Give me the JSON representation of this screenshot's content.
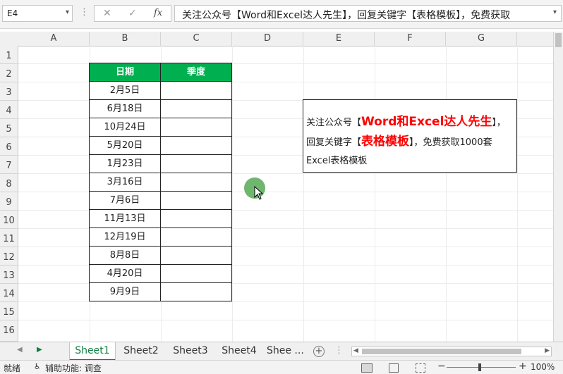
{
  "formula_bar": {
    "name_box": "E4",
    "cancel_glyph": "✕",
    "enter_glyph": "✓",
    "fx_label": "fx",
    "formula_text": "关注公众号【Word和Excel达人先生】，回复关键字【表格模板】，免费获取"
  },
  "columns": [
    "A",
    "B",
    "C",
    "D",
    "E",
    "F",
    "G"
  ],
  "rows": [
    "1",
    "2",
    "3",
    "4",
    "5",
    "6",
    "7",
    "8",
    "9",
    "10",
    "11",
    "12",
    "13",
    "14",
    "15",
    "16"
  ],
  "table": {
    "headers": [
      "日期",
      "季度"
    ],
    "dates": [
      "2月5日",
      "6月18日",
      "10月24日",
      "5月20日",
      "1月23日",
      "3月16日",
      "7月6日",
      "11月13日",
      "12月19日",
      "8月8日",
      "4月20日",
      "9月9日"
    ],
    "header_color": "#00b050"
  },
  "note": {
    "part1": "关注公众号【",
    "highlight1": "Word和Excel达人先生",
    "part2": "】，回复关键字【",
    "highlight2": "表格模板",
    "part3": "】，免费获取1000套Excel表格模板",
    "highlight_color": "#ff0000"
  },
  "sheets": [
    "Sheet1",
    "Sheet2",
    "Sheet3",
    "Sheet4",
    "Shee ..."
  ],
  "active_sheet": "Sheet1",
  "add_sheet_glyph": "+",
  "status_bar": {
    "ready": "就绪",
    "accessibility": "辅助功能: 调查",
    "zoom": "100%",
    "zoom_minus": "−",
    "zoom_plus": "+"
  },
  "icons": [
    "dropdown-icon",
    "cancel-icon",
    "enter-icon",
    "fx-icon",
    "add-sheet-icon",
    "normal-view-icon",
    "page-layout-icon",
    "page-break-icon",
    "accessibility-icon"
  ]
}
